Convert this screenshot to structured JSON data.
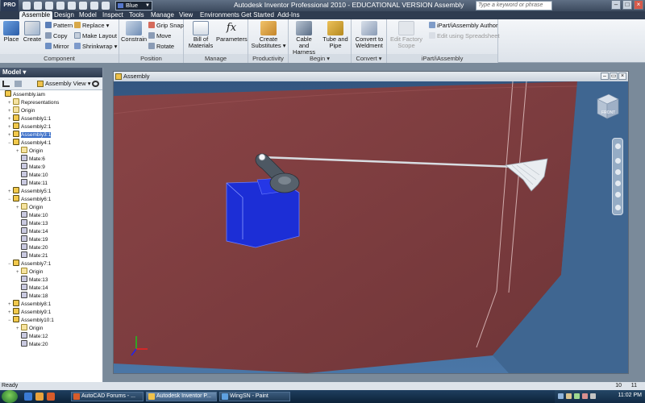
{
  "titlebar": {
    "logo": "PRO",
    "style_value": "Blue Gray",
    "title": "Autodesk Inventor Professional 2010 - EDUCATIONAL VERSION     Assembly",
    "search_placeholder": "Type a keyword or phrase",
    "minimize": "–",
    "maximize": "□",
    "close": "×"
  },
  "tabs": [
    {
      "label": "Assemble",
      "active": true
    },
    {
      "label": "Design"
    },
    {
      "label": "Model"
    },
    {
      "label": "Inspect"
    },
    {
      "label": "Tools"
    },
    {
      "label": "Manage"
    },
    {
      "label": "View"
    },
    {
      "label": "Environments"
    },
    {
      "label": "Get Started"
    },
    {
      "label": "Add-Ins"
    }
  ],
  "ribbon": {
    "component": {
      "label": "Component",
      "place": "Place",
      "create": "Create",
      "pattern": "Pattern",
      "copy": "Copy",
      "mirror": "Mirror",
      "replace": "Replace ▾",
      "make_layout": "Make Layout",
      "shrinkwrap": "Shrinkwrap ▾"
    },
    "position": {
      "label": "Position",
      "constrain": "Constrain",
      "grip_snap": "Grip Snap",
      "move": "Move",
      "rotate": "Rotate"
    },
    "manage": {
      "label": "Manage",
      "bom_line1": "Bill of",
      "bom_line2": "Materials",
      "parameters": "Parameters"
    },
    "productivity": {
      "label": "Productivity",
      "create_line1": "Create",
      "create_line2": "Substitutes ▾"
    },
    "begin": {
      "label": "Begin ▾",
      "cable_line1": "Cable and",
      "cable_line2": "Harness",
      "tube_line1": "Tube and",
      "tube_line2": "Pipe"
    },
    "convert": {
      "label": "Convert ▾",
      "line1": "Convert to",
      "line2": "Weldment"
    },
    "factory": {
      "line1": "Edit Factory",
      "line2": "Scope"
    },
    "ipart": {
      "label": "iPart/iAssembly",
      "author": "iPart/iAssembly Author",
      "edit": "Edit using Spreadsheet"
    }
  },
  "browser": {
    "header": "Model ▾",
    "view_label": "Assembly View ▾",
    "items": [
      {
        "label": "Assembly.iam",
        "type": "asm",
        "indent": 0,
        "exp": ""
      },
      {
        "label": "Representations",
        "type": "origin",
        "indent": 1,
        "exp": "+"
      },
      {
        "label": "Origin",
        "type": "origin",
        "indent": 1,
        "exp": "+"
      },
      {
        "label": "Assembly1:1",
        "type": "asm",
        "indent": 1,
        "exp": "+"
      },
      {
        "label": "Assembly2:1",
        "type": "asm",
        "indent": 1,
        "exp": "+"
      },
      {
        "label": "Assembly3:1",
        "type": "asm",
        "indent": 1,
        "exp": "+",
        "selected": true
      },
      {
        "label": "Assembly4:1",
        "type": "asm",
        "indent": 1,
        "exp": "−"
      },
      {
        "label": "Origin",
        "type": "origin",
        "indent": 2,
        "exp": "+"
      },
      {
        "label": "Mate:6",
        "type": "mate",
        "indent": 2,
        "exp": ""
      },
      {
        "label": "Mate:9",
        "type": "mate",
        "indent": 2,
        "exp": ""
      },
      {
        "label": "Mate:10",
        "type": "mate",
        "indent": 2,
        "exp": ""
      },
      {
        "label": "Mate:11",
        "type": "mate",
        "indent": 2,
        "exp": ""
      },
      {
        "label": "Assembly5:1",
        "type": "asm",
        "indent": 1,
        "exp": "+"
      },
      {
        "label": "Assembly6:1",
        "type": "asm",
        "indent": 1,
        "exp": "−"
      },
      {
        "label": "Origin",
        "type": "origin",
        "indent": 2,
        "exp": "+"
      },
      {
        "label": "Mate:10",
        "type": "mate",
        "indent": 2,
        "exp": ""
      },
      {
        "label": "Mate:13",
        "type": "mate",
        "indent": 2,
        "exp": ""
      },
      {
        "label": "Mate:14",
        "type": "mate",
        "indent": 2,
        "exp": ""
      },
      {
        "label": "Mate:19",
        "type": "mate",
        "indent": 2,
        "exp": ""
      },
      {
        "label": "Mate:20",
        "type": "mate",
        "indent": 2,
        "exp": ""
      },
      {
        "label": "Mate:21",
        "type": "mate",
        "indent": 2,
        "exp": ""
      },
      {
        "label": "Assembly7:1",
        "type": "asm",
        "indent": 1,
        "exp": "−"
      },
      {
        "label": "Origin",
        "type": "origin",
        "indent": 2,
        "exp": "+"
      },
      {
        "label": "Mate:13",
        "type": "mate",
        "indent": 2,
        "exp": ""
      },
      {
        "label": "Mate:14",
        "type": "mate",
        "indent": 2,
        "exp": ""
      },
      {
        "label": "Mate:18",
        "type": "mate",
        "indent": 2,
        "exp": ""
      },
      {
        "label": "Assembly8:1",
        "type": "asm",
        "indent": 1,
        "exp": "+"
      },
      {
        "label": "Assembly9:1",
        "type": "asm",
        "indent": 1,
        "exp": "+"
      },
      {
        "label": "Assembly10:1",
        "type": "asm",
        "indent": 1,
        "exp": "−"
      },
      {
        "label": "Origin",
        "type": "origin",
        "indent": 2,
        "exp": "+"
      },
      {
        "label": "Mate:12",
        "type": "mate",
        "indent": 2,
        "exp": ""
      },
      {
        "label": "Mate:20",
        "type": "mate",
        "indent": 2,
        "exp": ""
      }
    ]
  },
  "viewport": {
    "title": "Assembly",
    "viewcube_face": "FRONT",
    "colors": {
      "background": "#3b5f86",
      "surface": "#7b3a3d",
      "part_blue": "#1c2ed6",
      "part_gray": "#4b5560"
    }
  },
  "status": {
    "text": "Ready",
    "count_a": "10",
    "count_b": "11"
  },
  "taskbar": {
    "tasks": [
      {
        "label": "AutoCAD Forums - ...",
        "active": false
      },
      {
        "label": "Autodesk Inventor P...",
        "active": true
      },
      {
        "label": "WingSN - Paint",
        "active": false
      }
    ],
    "clock": "11:02 PM"
  }
}
